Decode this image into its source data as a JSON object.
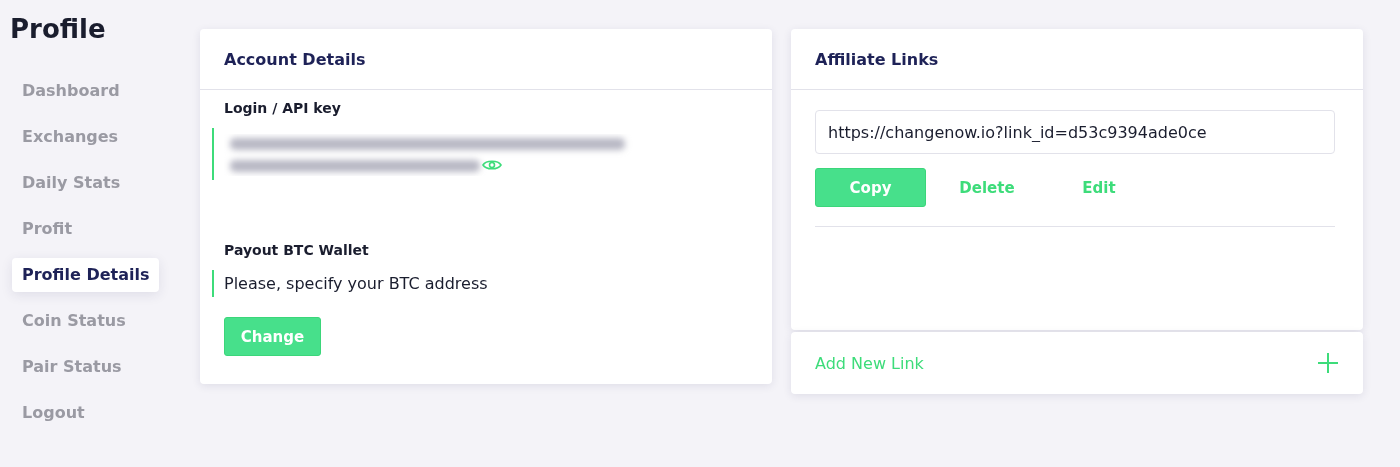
{
  "page_title": "Profile",
  "sidebar": {
    "items": [
      {
        "label": "Dashboard",
        "selected": false
      },
      {
        "label": "Exchanges",
        "selected": false
      },
      {
        "label": "Daily Stats",
        "selected": false
      },
      {
        "label": "Profit",
        "selected": false
      },
      {
        "label": "Profile Details",
        "selected": true
      },
      {
        "label": "Coin Status",
        "selected": false
      },
      {
        "label": "Pair Status",
        "selected": false
      },
      {
        "label": "Logout",
        "selected": false
      }
    ]
  },
  "account_details": {
    "title": "Account Details",
    "api_key_label": "Login / API key",
    "payout_label": "Payout BTC Wallet",
    "payout_value": "Please, specify your BTC address",
    "change_button": "Change"
  },
  "affiliate_links": {
    "title": "Affiliate Links",
    "link_value": "https://changenow.io?link_id=d53c9394ade0ce",
    "buttons": [
      {
        "label": "Copy",
        "kind": "primary"
      },
      {
        "label": "Delete",
        "kind": "text"
      },
      {
        "label": "Edit",
        "kind": "text"
      }
    ],
    "add_link": "Add New Link"
  }
}
